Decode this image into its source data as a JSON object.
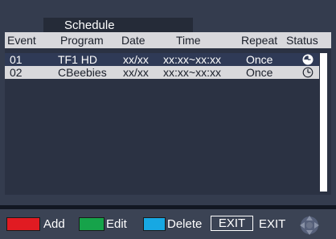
{
  "screen": {
    "title": "Schedule"
  },
  "table": {
    "headers": [
      "Event",
      "Program",
      "Date",
      "Time",
      "Repeat",
      "Status"
    ],
    "rows": [
      {
        "event": "01",
        "program": "TF1 HD",
        "date": "xx/xx",
        "time": "xx:xx~xx:xx",
        "repeat": "Once",
        "status_icon": "clock-icon",
        "selected": true
      },
      {
        "event": "02",
        "program": "CBeebies",
        "date": "xx/xx",
        "time": "xx:xx~xx:xx",
        "repeat": "Once",
        "status_icon": "clock-icon",
        "selected": false
      }
    ]
  },
  "footer": {
    "add_label": "Add",
    "edit_label": "Edit",
    "delete_label": "Delete",
    "exit_key_label": "EXIT",
    "exit_label": "EXIT",
    "colors": {
      "add": "#e11b22",
      "edit": "#16a34a",
      "delete": "#17a8e3"
    },
    "nav_icon": "dpad-icon"
  }
}
